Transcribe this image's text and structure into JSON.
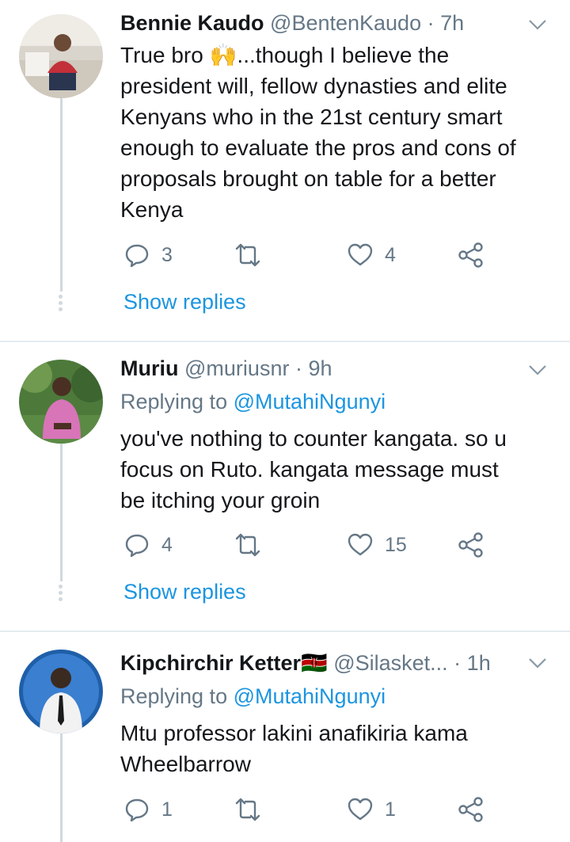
{
  "tweets": [
    {
      "name": "Bennie Kaudo",
      "handle": "@BentenKaudo",
      "separator": "·",
      "time": "7h",
      "text_lines": [
        "True bro 🙌...though I believe the",
        "president will, fellow dynasties and elite",
        "Kenyans who in the 21st century smart",
        "enough to evaluate the pros and cons of",
        "proposals brought on table for a better",
        "Kenya"
      ],
      "replies": "3",
      "retweets": "",
      "likes": "4",
      "show_replies": "Show replies"
    },
    {
      "name": "Muriu",
      "handle": "@muriusnr",
      "separator": "·",
      "time": "9h",
      "replying_prefix": "Replying to",
      "replying_to": "@MutahiNgunyi",
      "text_lines": [
        "you've nothing to counter kangata. so u",
        "focus on Ruto. kangata message must",
        "be itching your groin"
      ],
      "replies": "4",
      "retweets": "",
      "likes": "15",
      "show_replies": "Show replies"
    },
    {
      "name": "Kipchirchir Ketter🇰🇪",
      "handle": "@Silasket...",
      "separator": "·",
      "time": "1h",
      "replying_prefix": "Replying to",
      "replying_to": "@MutahiNgunyi",
      "text_lines": [
        "Mtu professor lakini anafikiria kama",
        "Wheelbarrow"
      ],
      "replies": "1",
      "retweets": "",
      "likes": "1"
    }
  ],
  "colors": {
    "accent": "#1b95e0",
    "muted": "#657786",
    "line": "#cfd9de"
  }
}
